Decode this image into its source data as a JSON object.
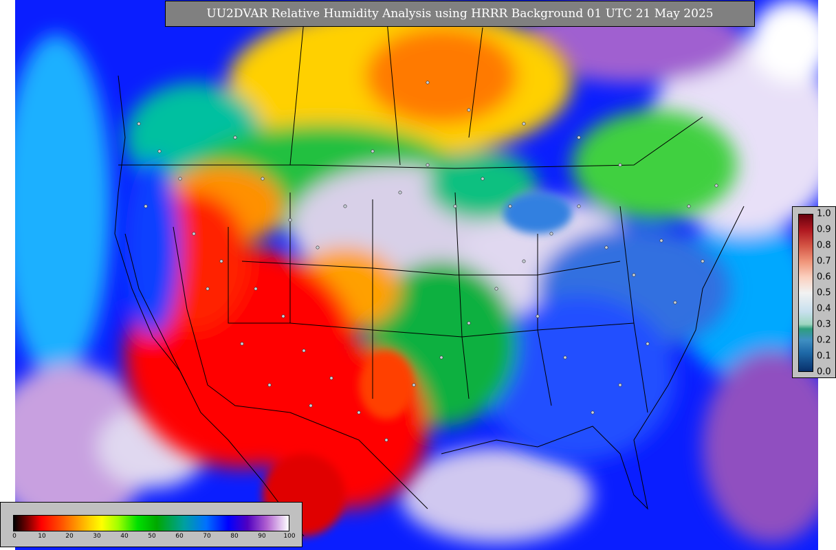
{
  "title": "UU2DVAR Relative Humidity Analysis using HRRR Background 01 UTC 21 May 2025",
  "map_colorbar": {
    "ticks": [
      "0",
      "10",
      "20",
      "30",
      "40",
      "50",
      "60",
      "70",
      "80",
      "90",
      "100"
    ]
  },
  "obs_colorbar": {
    "ticks": [
      "1.0",
      "0.9",
      "0.8",
      "0.7",
      "0.6",
      "0.5",
      "0.4",
      "0.3",
      "0.2",
      "0.1",
      "0.0"
    ]
  },
  "colors": {
    "frame_gray": "#c0c0c0",
    "title_bg": "#808080",
    "ocean": "#1a3cff",
    "dry": "#ff0000",
    "moist": "#00c000"
  }
}
